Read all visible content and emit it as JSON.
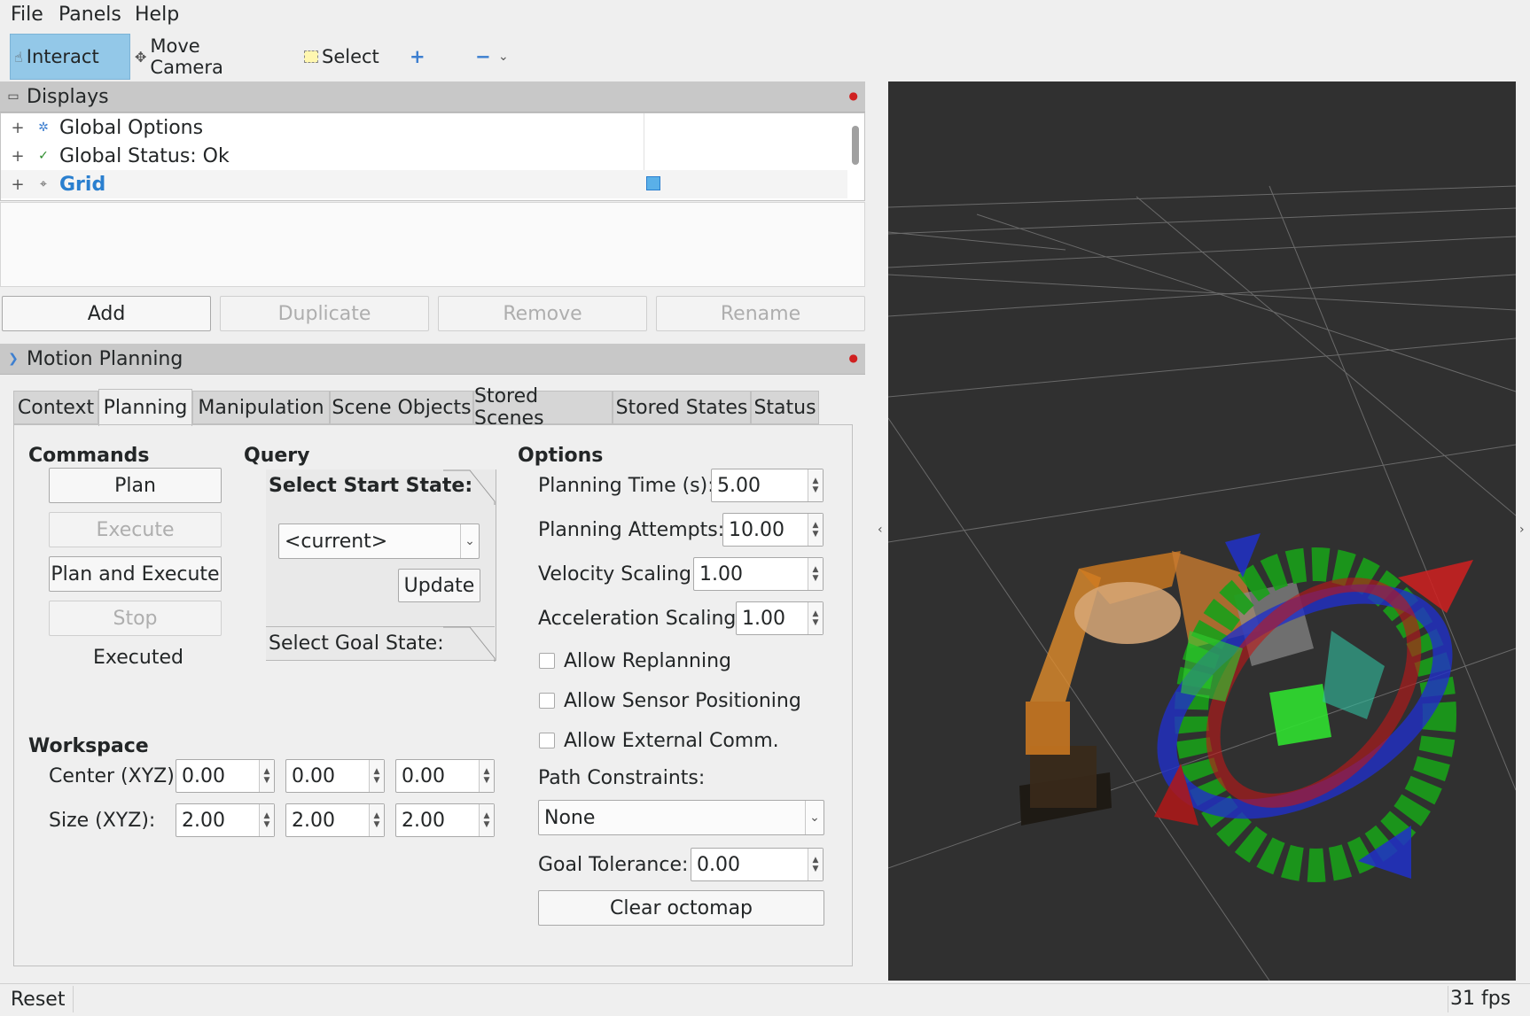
{
  "menu": {
    "file": "File",
    "panels": "Panels",
    "help": "Help"
  },
  "toolbar": {
    "interact": "Interact",
    "move_camera": "Move Camera",
    "select": "Select",
    "add_tool": "+",
    "remove_tool": "−",
    "more_tools": "⌄"
  },
  "displays": {
    "title": "Displays",
    "items": [
      {
        "label": "Global Options",
        "icon": "gear-icon"
      },
      {
        "label": "Global Status: Ok",
        "icon": "check-icon"
      },
      {
        "label": "Grid",
        "icon": "grid-icon",
        "enabled": true
      }
    ],
    "buttons": {
      "add": "Add",
      "duplicate": "Duplicate",
      "remove": "Remove",
      "rename": "Rename"
    }
  },
  "motion_planning": {
    "title": "Motion Planning",
    "tabs": [
      "Context",
      "Planning",
      "Manipulation",
      "Scene Objects",
      "Stored Scenes",
      "Stored States",
      "Status"
    ],
    "selected_tab": "Planning",
    "commands": {
      "title": "Commands",
      "plan": "Plan",
      "execute": "Execute",
      "plan_and_execute": "Plan and Execute",
      "stop": "Stop",
      "status": "Executed"
    },
    "query": {
      "title": "Query",
      "select_start_state": "Select Start State:",
      "start_state_value": "<current>",
      "update": "Update",
      "select_goal_state": "Select Goal State:"
    },
    "workspace": {
      "title": "Workspace",
      "center_label": "Center (XYZ):",
      "center": [
        "0.00",
        "0.00",
        "0.00"
      ],
      "size_label": "Size (XYZ):",
      "size": [
        "2.00",
        "2.00",
        "2.00"
      ]
    },
    "options": {
      "title": "Options",
      "planning_time_label": "Planning Time (s):",
      "planning_time": "5.00",
      "planning_attempts_label": "Planning Attempts:",
      "planning_attempts": "10.00",
      "velocity_scaling_label": "Velocity Scaling:",
      "velocity_scaling": "1.00",
      "acceleration_scaling_label": "Acceleration Scaling:",
      "acceleration_scaling": "1.00",
      "allow_replanning": "Allow Replanning",
      "allow_sensor_positioning": "Allow Sensor Positioning",
      "allow_external_comm": "Allow External Comm.",
      "path_constraints_label": "Path Constraints:",
      "path_constraints": "None",
      "goal_tolerance_label": "Goal Tolerance:",
      "goal_tolerance": "0.00",
      "clear_octomap": "Clear octomap"
    }
  },
  "statusbar": {
    "reset": "Reset",
    "fps": "31 fps"
  },
  "colors": {
    "accent": "#93c8e8",
    "viewport_bg": "#303030",
    "grid_link": "#2a7fcf"
  }
}
